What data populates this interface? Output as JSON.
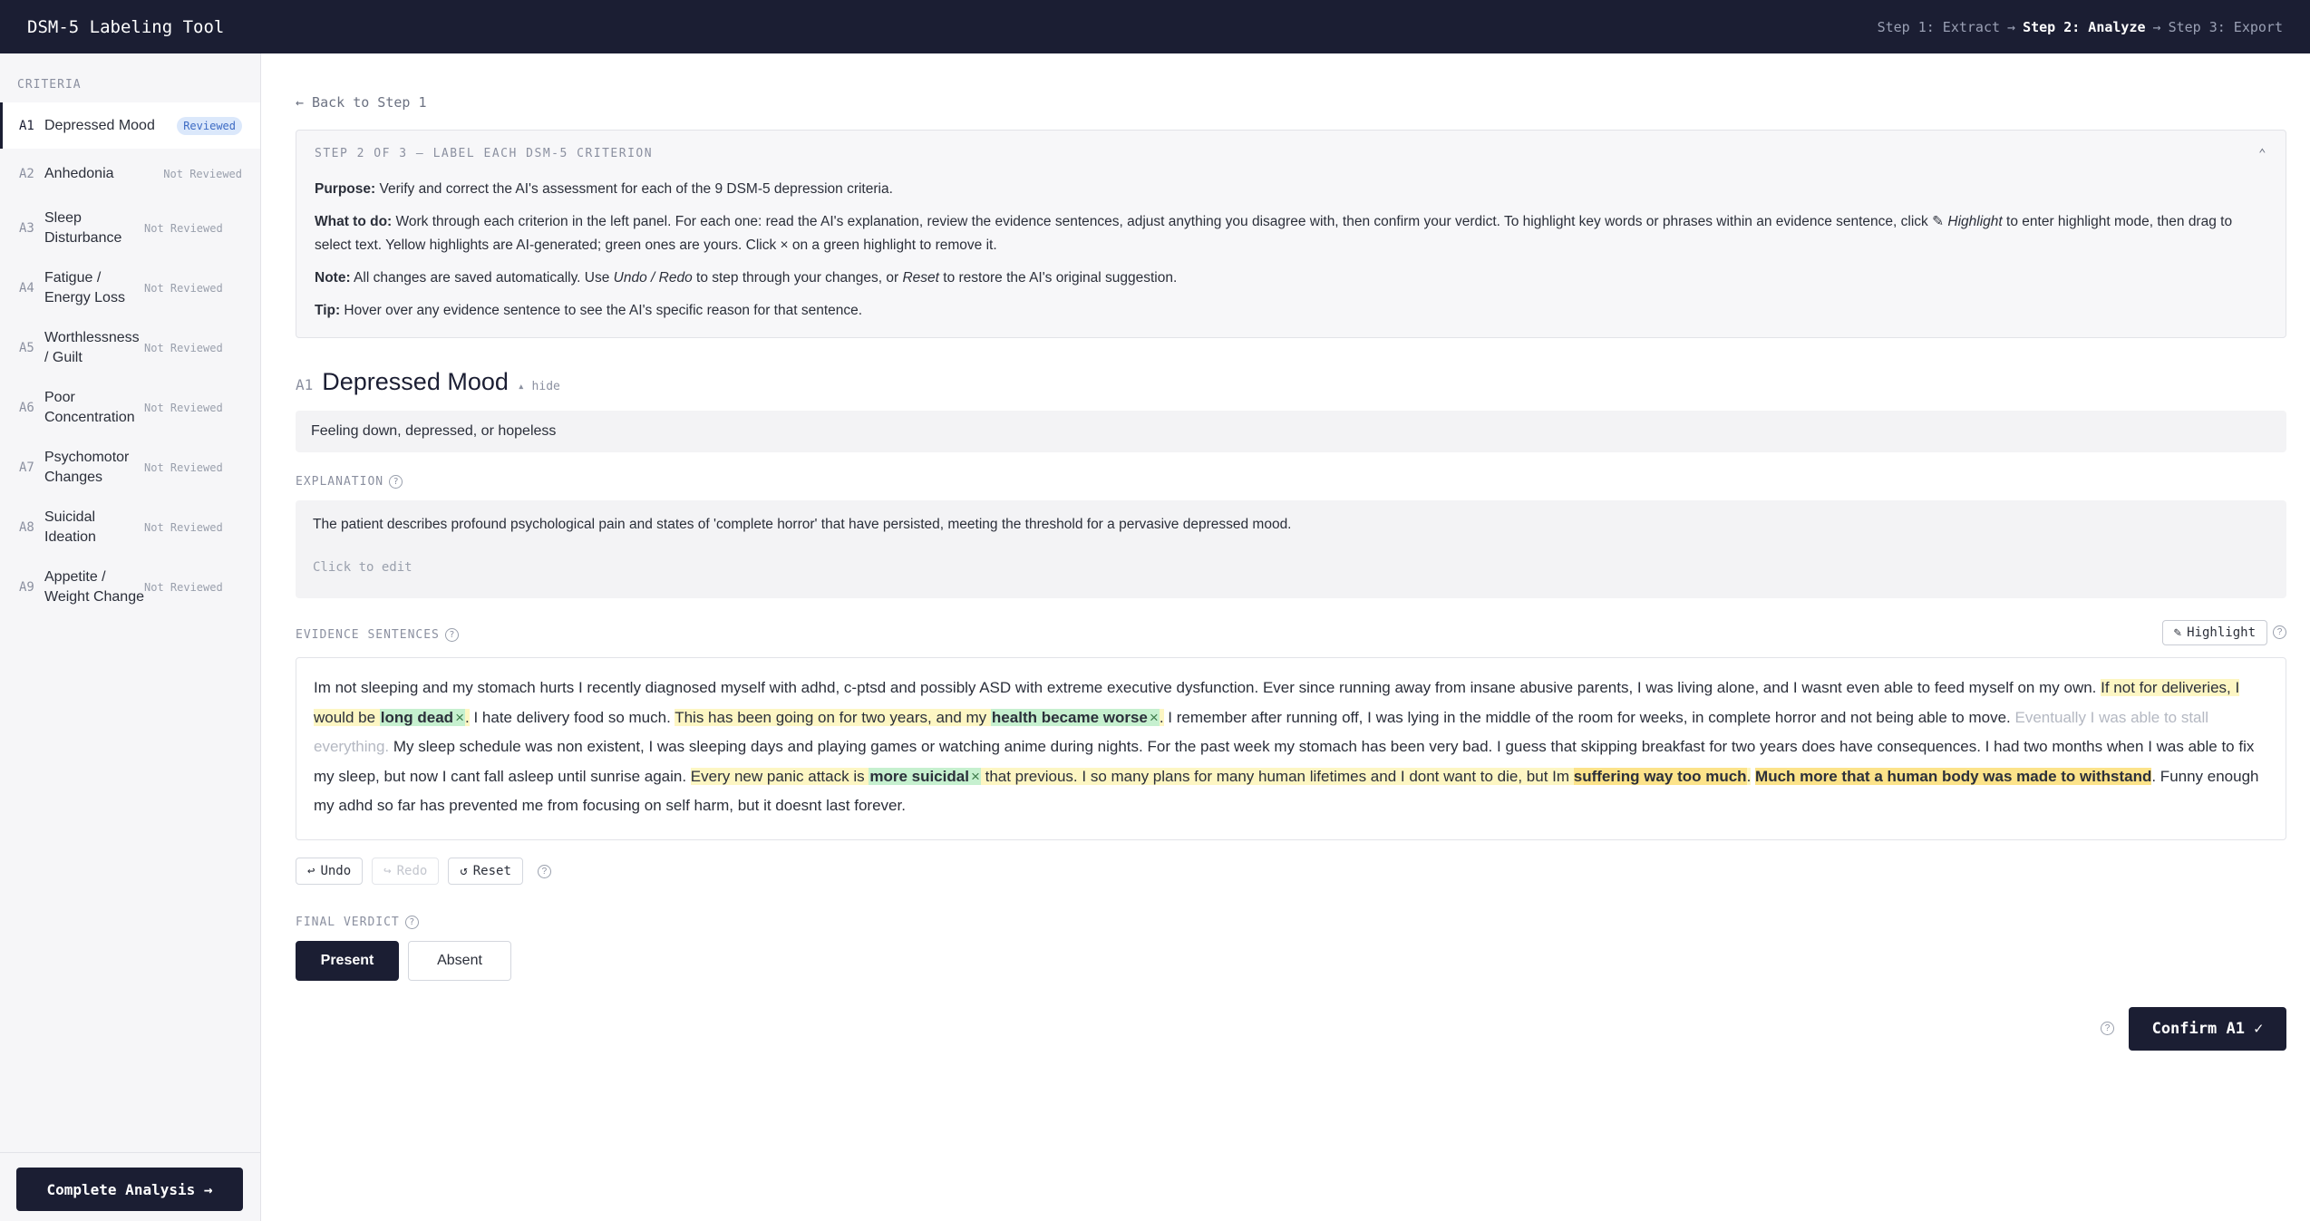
{
  "header": {
    "title": "DSM-5 Labeling Tool",
    "step1": "Step 1: Extract",
    "arrow1": "→",
    "step2": "Step 2: Analyze",
    "arrow2": "→",
    "step3": "Step 3: Export"
  },
  "sidebar": {
    "heading": "CRITERIA",
    "items": [
      {
        "code": "A1",
        "label": "Depressed Mood",
        "status": "Reviewed"
      },
      {
        "code": "A2",
        "label": "Anhedonia",
        "status": "Not Reviewed"
      },
      {
        "code": "A3",
        "label": "Sleep Disturbance",
        "status": "Not Reviewed"
      },
      {
        "code": "A4",
        "label": "Fatigue / Energy Loss",
        "status": "Not Reviewed"
      },
      {
        "code": "A5",
        "label": "Worthlessness / Guilt",
        "status": "Not Reviewed"
      },
      {
        "code": "A6",
        "label": "Poor Concentration",
        "status": "Not Reviewed"
      },
      {
        "code": "A7",
        "label": "Psychomotor Changes",
        "status": "Not Reviewed"
      },
      {
        "code": "A8",
        "label": "Suicidal Ideation",
        "status": "Not Reviewed"
      },
      {
        "code": "A9",
        "label": "Appetite / Weight Change",
        "status": "Not Reviewed"
      }
    ],
    "complete_label": "Complete Analysis →"
  },
  "main": {
    "back_label": "← Back to Step 1",
    "info": {
      "heading": "STEP 2 OF 3 — LABEL EACH DSM-5 CRITERION",
      "collapse_glyph": "⌃",
      "purpose_label": "Purpose:",
      "purpose_text": " Verify and correct the AI's assessment for each of the 9 DSM-5 depression criteria.",
      "todo_label": "What to do:",
      "todo_text_1": " Work through each criterion in the left panel. For each one: read the AI's explanation, review the evidence sentences, adjust anything you disagree with, then confirm your verdict. To highlight key words or phrases within an evidence sentence, click ",
      "todo_pencil": "✎",
      "todo_highlight": "Highlight",
      "todo_text_2": " to enter highlight mode, then drag to select text. Yellow highlights are AI-generated; green ones are yours. Click × on a green highlight to remove it.",
      "note_label": "Note:",
      "note_text_1": " All changes are saved automatically. Use ",
      "note_undo_redo": "Undo / Redo",
      "note_text_2": " to step through your changes, or ",
      "note_reset": "Reset",
      "note_text_3": " to restore the AI's original suggestion.",
      "tip_label": "Tip:",
      "tip_text": " Hover over any evidence sentence to see the AI's specific reason for that sentence."
    },
    "criterion": {
      "code": "A1",
      "title": "Depressed Mood",
      "hide_label": "▴ hide",
      "description": "Feeling down, depressed, or hopeless"
    },
    "explanation": {
      "label": "EXPLANATION",
      "text": "The patient describes profound psychological pain and states of 'complete horror' that have persisted, meeting the threshold for a pervasive depressed mood.",
      "edit_hint": "Click to edit"
    },
    "evidence": {
      "label": "EVIDENCE SENTENCES",
      "highlight_button": "Highlight",
      "highlight_icon": "✎",
      "remove_glyph": "×",
      "seg1": "Im not sleeping and my stomach hurts I recently diagnosed myself with adhd, c-ptsd and possibly ASD with extreme executive dysfunction. Ever since running away from insane abusive parents, I was living alone, and I wasnt even able to feed myself on my own. ",
      "seg2a": "If not for deliveries, I would be ",
      "seg2b": "long dead",
      "seg2c": ".",
      "seg3": " I hate delivery food so much. ",
      "seg4a": "This has been going on for two years, and my ",
      "seg4b": "health became worse",
      "seg4c": ".",
      "seg5": " I remember after running off, I was lying in the middle of the room for weeks, in complete horror and not being able to move. ",
      "seg6": "Eventually I was able to stall everything.",
      "seg7": " My sleep schedule was non existent, I was sleeping days and playing games or watching anime during nights. For the past week my stomach has been very bad. I guess that skipping breakfast for two years does have consequences. I had two months when I was able to fix my sleep, but now I cant fall asleep until sunrise again. ",
      "seg8a": "Every new panic attack is ",
      "seg8b": "more suicidal",
      "seg8c": " that previous. I so many plans for many human lifetimes and I dont want to die, but Im ",
      "seg8d": "suffering way too much",
      "seg8e": ".",
      "seg9": "Much more that a human body was made to withstand",
      "seg10": ". Funny enough my adhd so far has prevented me from focusing on self harm, but it doesnt last forever."
    },
    "actions": {
      "undo": "Undo",
      "undo_icon": "↩",
      "redo": "Redo",
      "redo_icon": "↪",
      "reset": "Reset",
      "reset_icon": "↺"
    },
    "verdict": {
      "label": "FINAL VERDICT",
      "present": "Present",
      "absent": "Absent",
      "selected": "Present"
    },
    "confirm_label": "Confirm A1 ✓",
    "help_glyph": "?"
  },
  "colors": {
    "navy": "#1b1e33",
    "ai_highlight": "#fdf6c3",
    "ai_highlight_strong": "#fce38a",
    "user_highlight": "#c6f0cf",
    "reviewed_badge": "#dbe8fb"
  },
  "icons": [
    "pencil-icon",
    "undo-icon",
    "redo-icon",
    "reset-icon",
    "help-icon",
    "collapse-chevron-icon",
    "remove-x-icon"
  ]
}
